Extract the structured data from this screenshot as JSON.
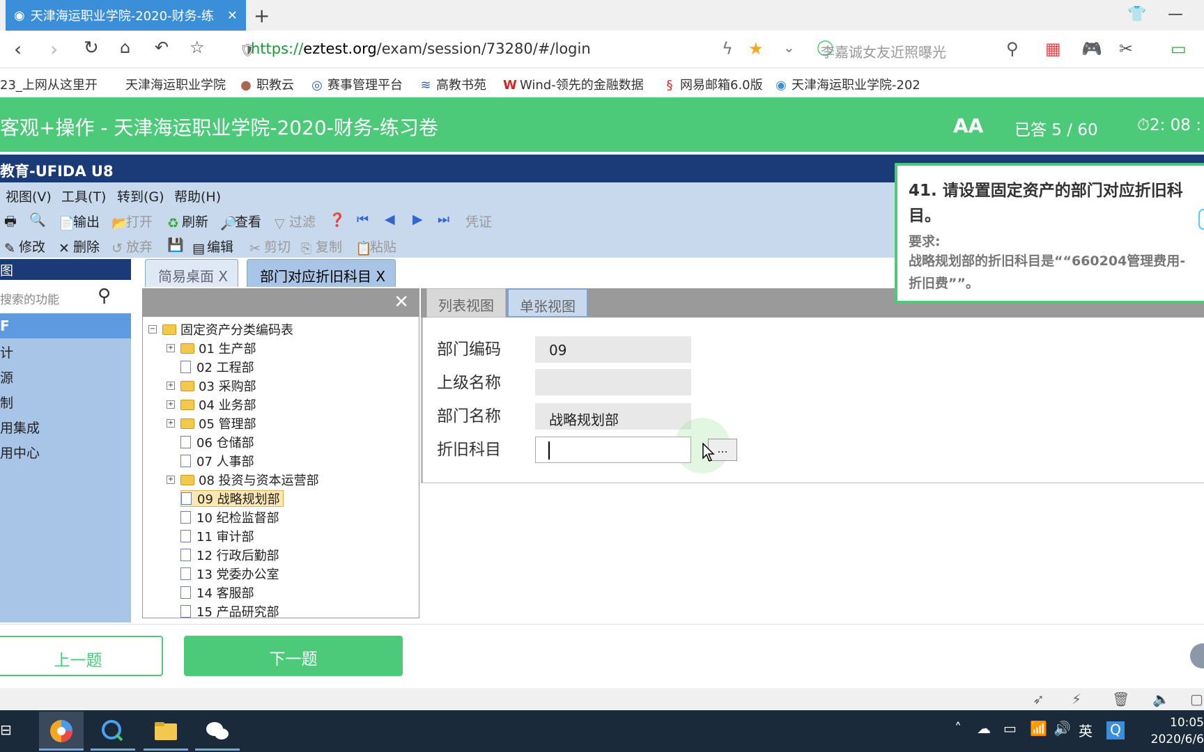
{
  "browser": {
    "tab_title": "天津海运职业学院-2020-财务-练",
    "url_scheme": "https://",
    "url_host": "eztest.org",
    "url_path": "/exam/session/73280/#/login",
    "search_hint": "李嘉诚女友近照曝光",
    "bookmarks": [
      "23_上网从这里开",
      "天津海运职业学院",
      "职教云",
      "赛事管理平台",
      "高教书苑",
      "Wind-领先的金融数据",
      "网易邮箱6.0版",
      "天津海运职业学院-202"
    ]
  },
  "exam": {
    "title": "客观+操作 - 天津海运职业学院-2020-财务-练习卷",
    "font_size_icon": "AA",
    "answered": "已答 5 / 60",
    "timer": "⏱2: 08 :"
  },
  "u8": {
    "title": "教育-UFIDA U8",
    "menu": [
      "视图(V)",
      "工具(T)",
      "转到(G)",
      "帮助(H)"
    ],
    "toolbar1": [
      "输出",
      "打开",
      "刷新",
      "查看",
      "过滤",
      "凭证"
    ],
    "toolbar2": [
      "修改",
      "删除",
      "放弃",
      "编辑",
      "剪切",
      "复制",
      "粘贴"
    ],
    "nav_header": "图",
    "nav_search_placeholder": "搜索的功能",
    "nav_active": "F",
    "nav_items": [
      "计",
      "源",
      "制",
      "用集成",
      "用中心"
    ],
    "tabs": [
      "简易桌面 X",
      "部门对应折旧科目 X"
    ],
    "view_tabs": [
      "列表视图",
      "单张视图"
    ],
    "tree_root": "固定资产分类编码表",
    "tree": [
      {
        "label": "01 生产部",
        "folder": true
      },
      {
        "label": "02 工程部",
        "folder": false
      },
      {
        "label": "03 采购部",
        "folder": true
      },
      {
        "label": "04 业务部",
        "folder": true
      },
      {
        "label": "05 管理部",
        "folder": true
      },
      {
        "label": "06 仓储部",
        "folder": false
      },
      {
        "label": "07 人事部",
        "folder": false
      },
      {
        "label": "08 投资与资本运营部",
        "folder": true
      },
      {
        "label": "09 战略规划部",
        "folder": false,
        "selected": true
      },
      {
        "label": "10 纪检监督部",
        "folder": false
      },
      {
        "label": "11 审计部",
        "folder": false
      },
      {
        "label": "12 行政后勤部",
        "folder": false
      },
      {
        "label": "13 党委办公室",
        "folder": false
      },
      {
        "label": "14 客服部",
        "folder": false
      },
      {
        "label": "15 产品研究部",
        "folder": false
      }
    ],
    "fields": {
      "dept_code_label": "部门编码",
      "dept_code": "09",
      "parent_name_label": "上级名称",
      "parent_name": "",
      "dept_name_label": "部门名称",
      "dept_name": "战略规划部",
      "depr_account_label": "折旧科目",
      "depr_account": "",
      "ref_button": "..."
    }
  },
  "question": {
    "title": "41. 请设置固定资产的部门对应折旧科目。",
    "req_label": "要求:",
    "req_text": "战略规划部的折旧科目是““660204管理费用-折旧费””。"
  },
  "footer": {
    "prev": "上一题",
    "next": "下一题"
  },
  "taskbar": {
    "time": "10:05",
    "date": "2020/6/6",
    "ime": "英"
  }
}
